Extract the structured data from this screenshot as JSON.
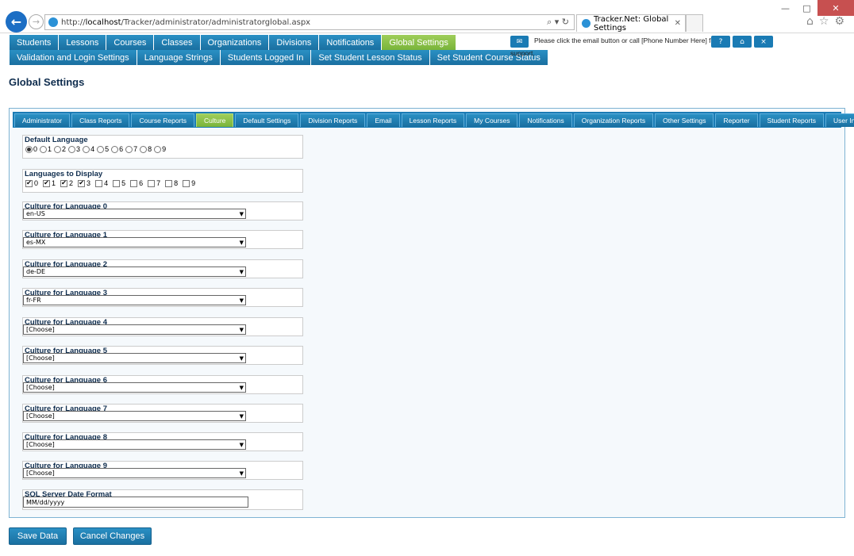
{
  "browser": {
    "url_prefix": "http://",
    "url_host": "localhost",
    "url_path": "/Tracker/administrator/administratorglobal.aspx",
    "tab_title": "Tracker.Net: Global Settings"
  },
  "main_menu": [
    {
      "label": "Students",
      "active": false
    },
    {
      "label": "Lessons",
      "active": false
    },
    {
      "label": "Courses",
      "active": false
    },
    {
      "label": "Classes",
      "active": false
    },
    {
      "label": "Organizations",
      "active": false
    },
    {
      "label": "Divisions",
      "active": false
    },
    {
      "label": "Notifications",
      "active": false
    },
    {
      "label": "Global Settings",
      "active": true
    }
  ],
  "sub_menu": [
    {
      "label": "Validation and Login Settings"
    },
    {
      "label": "Language Strings"
    },
    {
      "label": "Students Logged In"
    },
    {
      "label": "Set Student Lesson Status"
    },
    {
      "label": "Set Student Course Status"
    }
  ],
  "support": {
    "text_line1": "Please click the email button or call [Phone Number Here] for",
    "text_line2": "support.",
    "help_label": "?",
    "home_label": "⌂",
    "close_label": "×",
    "email_label": "✉"
  },
  "page_title": "Global Settings",
  "tabs": [
    {
      "label": "Administrator",
      "active": false
    },
    {
      "label": "Class Reports",
      "active": false
    },
    {
      "label": "Course Reports",
      "active": false
    },
    {
      "label": "Culture",
      "active": true
    },
    {
      "label": "Default Settings",
      "active": false
    },
    {
      "label": "Division Reports",
      "active": false
    },
    {
      "label": "Email",
      "active": false
    },
    {
      "label": "Lesson Reports",
      "active": false
    },
    {
      "label": "My Courses",
      "active": false
    },
    {
      "label": "Notifications",
      "active": false
    },
    {
      "label": "Organization Reports",
      "active": false
    },
    {
      "label": "Other Settings",
      "active": false
    },
    {
      "label": "Reporter",
      "active": false
    },
    {
      "label": "Student Reports",
      "active": false
    },
    {
      "label": "User Interface",
      "active": false
    }
  ],
  "default_language": {
    "label": "Default Language",
    "options": [
      "0",
      "1",
      "2",
      "3",
      "4",
      "5",
      "6",
      "7",
      "8",
      "9"
    ],
    "selected": "0"
  },
  "languages_to_display": {
    "label": "Languages to Display",
    "options": [
      "0",
      "1",
      "2",
      "3",
      "4",
      "5",
      "6",
      "7",
      "8",
      "9"
    ],
    "checked": [
      "0",
      "1",
      "2",
      "3"
    ]
  },
  "cultures": [
    {
      "label": "Culture for Language 0",
      "value": "en-US"
    },
    {
      "label": "Culture for Language 1",
      "value": "es-MX"
    },
    {
      "label": "Culture for Language 2",
      "value": "de-DE"
    },
    {
      "label": "Culture for Language 3",
      "value": "fr-FR"
    },
    {
      "label": "Culture for Language 4",
      "value": "[Choose]"
    },
    {
      "label": "Culture for Language 5",
      "value": "[Choose]"
    },
    {
      "label": "Culture for Language 6",
      "value": "[Choose]"
    },
    {
      "label": "Culture for Language 7",
      "value": "[Choose]"
    },
    {
      "label": "Culture for Language 8",
      "value": "[Choose]"
    },
    {
      "label": "Culture for Language 9",
      "value": "[Choose]"
    }
  ],
  "sql_date": {
    "label": "SQL Server Date Format",
    "value": "MM/dd/yyyy"
  },
  "actions": {
    "save_label": "Save Data",
    "cancel_label": "Cancel Changes"
  }
}
